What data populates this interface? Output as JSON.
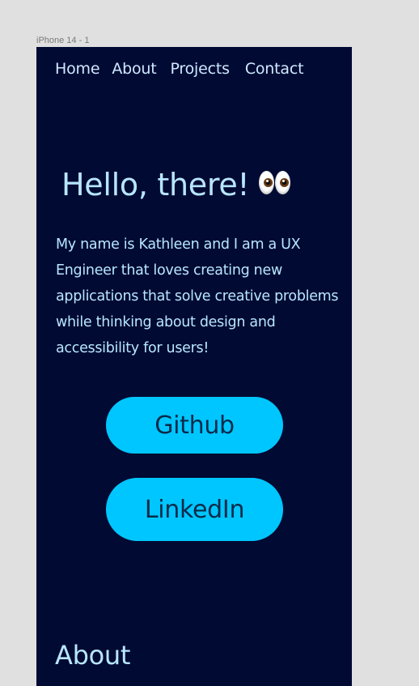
{
  "canvas": {
    "frame_label": "iPhone 14 - 1"
  },
  "nav": {
    "items": [
      {
        "label": "Home"
      },
      {
        "label": "About"
      },
      {
        "label": "Projects"
      },
      {
        "label": "Contact"
      }
    ]
  },
  "hero": {
    "title": "Hello, there!",
    "emoji": "eyes-emoji",
    "intro": "My name is Kathleen and I am a UX Engineer that loves creating new applications that solve creative problems while thinking about design and accessibility for users!"
  },
  "buttons": {
    "github_label": "Github",
    "linkedin_label": "LinkedIn"
  },
  "about": {
    "heading": "About"
  },
  "colors": {
    "canvas_background": "#e0e0e0",
    "page_background": "#000a33",
    "text": "#b8e6ff",
    "button_background": "#00c6ff",
    "button_text": "#0a2a4a"
  }
}
